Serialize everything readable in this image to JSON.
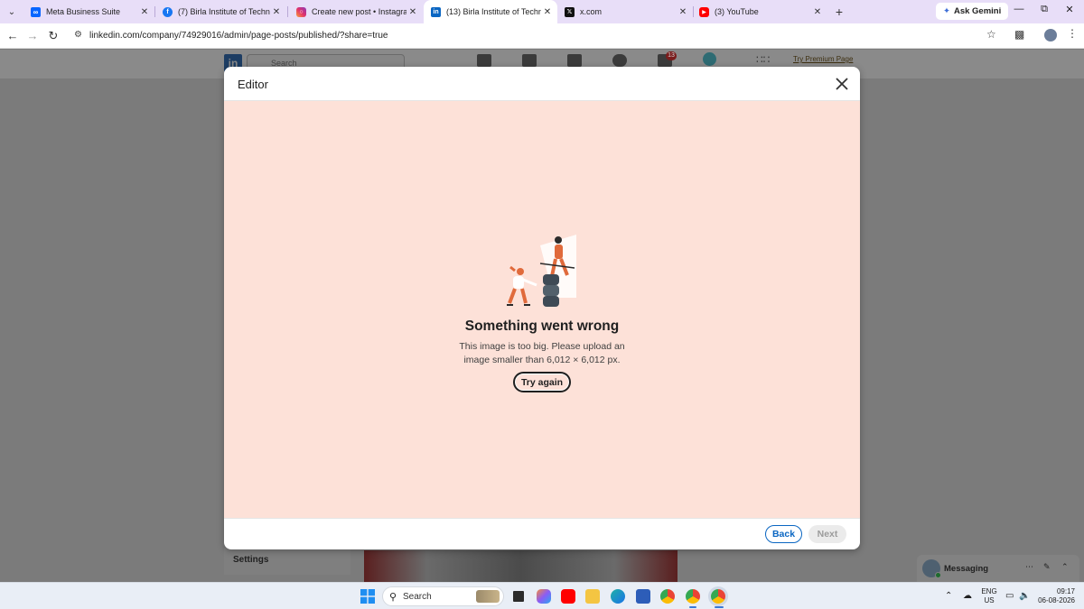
{
  "browser": {
    "tabs": [
      {
        "title": "Meta Business Suite",
        "icon": "meta-icon",
        "active": false
      },
      {
        "title": "(7) Birla Institute of Technology",
        "icon": "facebook-icon",
        "active": false
      },
      {
        "title": "Create new post • Instagram",
        "icon": "instagram-icon",
        "active": false
      },
      {
        "title": "(13) Birla Institute of Technology",
        "icon": "linkedin-icon",
        "active": true
      },
      {
        "title": "x.com",
        "icon": "x-icon",
        "active": false
      },
      {
        "title": "(3) YouTube",
        "icon": "youtube-icon",
        "active": false
      }
    ],
    "gemini_label": "Ask Gemini",
    "url": "linkedin.com/company/74929016/admin/page-posts/published/?share=true"
  },
  "linkedin": {
    "search_placeholder": "Search",
    "notification_count": "13",
    "premium_link": "Try Premium Page",
    "settings_label": "Settings",
    "messaging_label": "Messaging"
  },
  "modal": {
    "title": "Editor",
    "error_title": "Something went wrong",
    "error_message": "This image is too big. Please upload an image smaller than 6,012 × 6,012 px.",
    "try_again_label": "Try again",
    "back_label": "Back",
    "next_label": "Next"
  },
  "taskbar": {
    "search_label": "Search",
    "lang_line1": "ENG",
    "lang_line2": "US",
    "time": "09:17",
    "date": "06-08-2026"
  },
  "colors": {
    "linkedin_blue": "#0a66c2",
    "error_bg": "#fde1d8",
    "tabstrip": "#e8def8"
  }
}
